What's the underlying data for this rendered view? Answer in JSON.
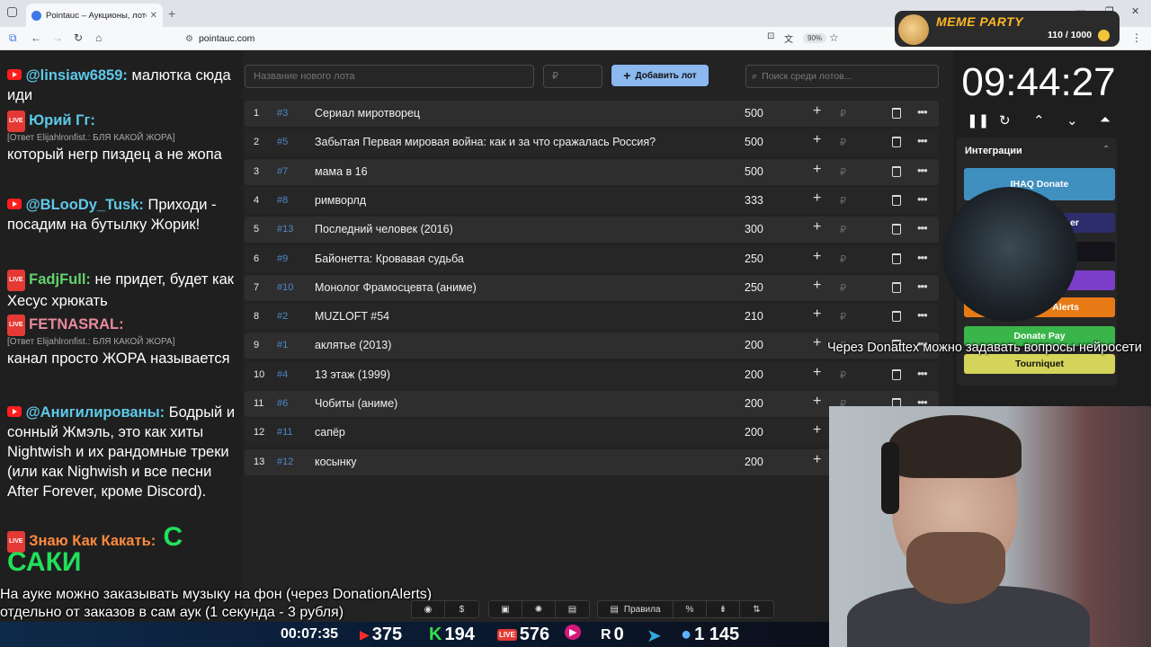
{
  "browser": {
    "tab_title": "Pointauc – Аукционы, лотереи",
    "url": "pointauc.com",
    "zoom": "90%"
  },
  "overlay": {
    "meme_title": "MEME PARTY",
    "meme_count": "110 / 1000"
  },
  "chat": [
    {
      "nick": "@linsiaw6859:",
      "text": " малютка сюда иди"
    },
    {
      "nick": "Юрий Гг:",
      "reply": "[Ответ Elijahlronfist.: БЛЯ КАКОЙ ЖОРА]",
      "text": "который негр пиздец а не жопа"
    },
    {
      "nick": "@BLooDy_Tusk:",
      "text": " Приходи - посадим на бутылку Жорик!"
    },
    {
      "nick": "FadjFull:",
      "text": " не придет, будет как Хесус хрюкать"
    },
    {
      "nick": "FETNASRAL:",
      "reply": "[Ответ Elijahlronfist.: БЛЯ КАКОЙ ЖОРА]",
      "text": "канал просто ЖОРА называется"
    },
    {
      "nick": "@Анигилированы:",
      "text": " Бодрый и сонный Жмэль, это как хиты Nightwish и их рандомные треки (или как Nighwish и все песни After Forever, кроме Discord)."
    },
    {
      "nick": "Знаю Как Какать:",
      "text": " С САКИ"
    }
  ],
  "auction": {
    "new_lot_placeholder": "Название нового лота",
    "amount_placeholder": "₽",
    "add_button": "Добавить лот",
    "search_placeholder": "Поиск среди лотов...",
    "rows": [
      {
        "n": "1",
        "id": "#3",
        "name": "Сериал миротворец",
        "amount": "500"
      },
      {
        "n": "2",
        "id": "#5",
        "name": "Забытая Первая мировая война: как и за что сражалась Россия?",
        "amount": "500"
      },
      {
        "n": "3",
        "id": "#7",
        "name": "мама в 16",
        "amount": "500"
      },
      {
        "n": "4",
        "id": "#8",
        "name": "римворлд",
        "amount": "333"
      },
      {
        "n": "5",
        "id": "#13",
        "name": "Последний человек (2016)",
        "amount": "300"
      },
      {
        "n": "6",
        "id": "#9",
        "name": "Байонетта: Кровавая судьба",
        "amount": "250"
      },
      {
        "n": "7",
        "id": "#10",
        "name": "Монолог Фрамосцевта (аниме)",
        "amount": "250"
      },
      {
        "n": "8",
        "id": "#2",
        "name": "MUZLOFT #54",
        "amount": "210"
      },
      {
        "n": "9",
        "id": "#1",
        "name": "аклятье (2013)",
        "amount": "200"
      },
      {
        "n": "10",
        "id": "#4",
        "name": "13 этаж (1999)",
        "amount": "200"
      },
      {
        "n": "11",
        "id": "#6",
        "name": "Чобиты (аниме)",
        "amount": "200"
      },
      {
        "n": "12",
        "id": "#11",
        "name": "сапёр",
        "amount": "200"
      },
      {
        "n": "13",
        "id": "#12",
        "name": "косынку",
        "amount": "200"
      }
    ]
  },
  "right": {
    "timer": "09:44:27",
    "integrations_title": "Интеграции",
    "integrations": [
      {
        "label": "IHAQ Donate",
        "color": "#3f8fbf"
      },
      {
        "label": "er",
        "color": "#2c2d6b"
      },
      {
        "label": "",
        "color": "#15141a"
      },
      {
        "label": "",
        "color": "#7a3ec8"
      },
      {
        "label": "Alerts",
        "color": "#e87a16"
      },
      {
        "label": "Donate Pay",
        "color": "#39b54a"
      },
      {
        "label": "Tourniquet",
        "color": "#d4d45a"
      }
    ],
    "overlay_text": "Через Donattex можно задавать вопросы нейросети"
  },
  "captions": {
    "line1": "На ауке можно заказывать музыку на фон (через DonationAlerts)",
    "line2": "отдельно от заказов в сам аук (1 секунда - 3 рубля)"
  },
  "tools": {
    "rules": "Правила"
  },
  "stats": {
    "uptime": "00:07:35",
    "youtube": "375",
    "kick": "194",
    "live": "576",
    "rutube": "0",
    "telegram": "",
    "viewers": "1 145"
  }
}
